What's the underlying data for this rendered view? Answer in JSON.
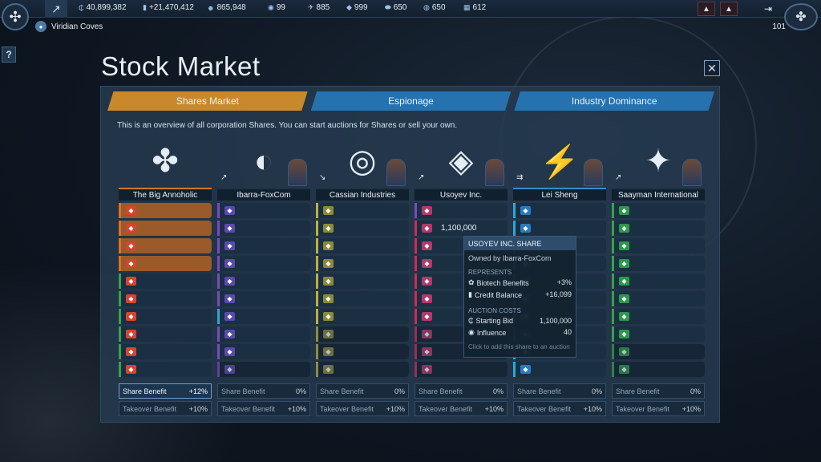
{
  "topbar": {
    "stats": [
      {
        "icon": "credits-icon",
        "glyph": "₵",
        "value": "40,899,382"
      },
      {
        "icon": "income-icon",
        "glyph": "▮",
        "value": "+21,470,412"
      },
      {
        "icon": "population-icon",
        "glyph": "☻",
        "value": "865,948"
      },
      {
        "icon": "influence-icon",
        "glyph": "◉",
        "value": "99"
      },
      {
        "icon": "ships-icon",
        "glyph": "✈",
        "value": "885"
      },
      {
        "icon": "resource-a-icon",
        "glyph": "◆",
        "value": "999"
      },
      {
        "icon": "resource-b-icon",
        "glyph": "⬬",
        "value": "650"
      },
      {
        "icon": "resource-c-icon",
        "glyph": "◍",
        "value": "650"
      },
      {
        "icon": "resource-d-icon",
        "glyph": "▦",
        "value": "612"
      }
    ],
    "location": "Viridian Coves",
    "level": "101"
  },
  "page": {
    "title": "Stock Market",
    "intro": "This is an overview of all corporation Shares. You can start auctions for Shares or sell your own."
  },
  "tabs": [
    {
      "label": "Shares Market",
      "active": true
    },
    {
      "label": "Espionage",
      "active": false
    },
    {
      "label": "Industry Dominance",
      "active": false
    }
  ],
  "corporations": [
    {
      "name": "The Big Annoholic",
      "logo": "✤",
      "icon_color": "#d7442e",
      "bar_colors": [
        "#e0701e",
        "#e0701e",
        "#e0701e",
        "#e0701e",
        "#3aa04a",
        "#3aa04a",
        "#3aa04a",
        "#3aa04a",
        "#3aa04a",
        "#3aa04a"
      ],
      "orange_rows": 4,
      "dim_from": 10,
      "share_benefit_label": "Share Benefit",
      "share_benefit_value": "+12%",
      "takeover_label": "Takeover Benefit",
      "takeover_value": "+10%",
      "highlight": true,
      "trend": "",
      "ceo": false
    },
    {
      "name": "Ibarra-FoxCom",
      "logo": "◐",
      "icon_color": "#5a4ab0",
      "bar_colors": [
        "#7a4ac0",
        "#7a4ac0",
        "#7a4ac0",
        "#7a4ac0",
        "#7a4ac0",
        "#7a4ac0",
        "#2aa8d8",
        "#7a4ac0",
        "#7a4ac0",
        "#7a4ac0"
      ],
      "orange_rows": 0,
      "dim_from": 9,
      "share_benefit_label": "Share Benefit",
      "share_benefit_value": "0%",
      "takeover_label": "Takeover Benefit",
      "takeover_value": "+10%",
      "highlight": false,
      "trend": "↗",
      "ceo": true
    },
    {
      "name": "Cassian Industries",
      "logo": "◎",
      "icon_color": "#8a8a3a",
      "bar_colors": [
        "#c0b040",
        "#c0b040",
        "#c0b040",
        "#c0b040",
        "#c0b040",
        "#c0b040",
        "#c0b040",
        "#c0b040",
        "#c0b040",
        "#c0b040"
      ],
      "orange_rows": 0,
      "dim_from": 7,
      "share_benefit_label": "Share Benefit",
      "share_benefit_value": "0%",
      "takeover_label": "Takeover Benefit",
      "takeover_value": "+10%",
      "highlight": false,
      "trend": "↘",
      "ceo": true
    },
    {
      "name": "Usoyev Inc.",
      "logo": "◈",
      "icon_color": "#b03a6a",
      "bar_colors": [
        "#7a4ac0",
        "#d02a5a",
        "#d02a5a",
        "#d02a5a",
        "#d02a5a",
        "#d02a5a",
        "#d02a5a",
        "#d02a5a",
        "#d02a5a",
        "#d02a5a"
      ],
      "orange_rows": 0,
      "dim_from": 7,
      "share_benefit_label": "Share Benefit",
      "share_benefit_value": "0%",
      "takeover_label": "Takeover Benefit",
      "takeover_value": "+10%",
      "highlight": false,
      "trend": "↗",
      "ceo": true,
      "share_price": "1,100,000"
    },
    {
      "name": "Lei Sheng",
      "logo": "⚡",
      "icon_color": "#2a7ac0",
      "bar_colors": [
        "#2aa8d8",
        "#2aa8d8",
        "#2aa8d8",
        "#2aa8d8",
        "#2aa8d8",
        "#2aa8d8",
        "#2aa8d8",
        "#2aa8d8",
        "#2aa8d8",
        "#2aa8d8"
      ],
      "orange_rows": 0,
      "dim_from": 10,
      "share_benefit_label": "Share Benefit",
      "share_benefit_value": "0%",
      "takeover_label": "Takeover Benefit",
      "takeover_value": "+10%",
      "highlight": false,
      "trend": "⇉",
      "ceo": true
    },
    {
      "name": "Saayman International",
      "logo": "✦",
      "icon_color": "#2a9a4a",
      "bar_colors": [
        "#3aa04a",
        "#3aa04a",
        "#3aa04a",
        "#3aa04a",
        "#3aa04a",
        "#3aa04a",
        "#3aa04a",
        "#3aa04a",
        "#3aa04a",
        "#3aa04a"
      ],
      "orange_rows": 0,
      "dim_from": 8,
      "share_benefit_label": "Share Benefit",
      "share_benefit_value": "0%",
      "takeover_label": "Takeover Benefit",
      "takeover_value": "+10%",
      "highlight": false,
      "trend": "↗",
      "ceo": true
    }
  ],
  "tooltip": {
    "title": "USOYEV INC. SHARE",
    "owner": "Owned by Ibarra-FoxCom",
    "represents_label": "REPRESENTS",
    "represents": [
      {
        "label": "Biotech Benefits",
        "value": "+3%",
        "glyph": "✿"
      },
      {
        "label": "Credit Balance",
        "value": "+16,099",
        "glyph": "▮"
      }
    ],
    "auction_label": "AUCTION COSTS",
    "auction": [
      {
        "label": "Starting Bid",
        "value": "1,100,000",
        "glyph": "₵"
      },
      {
        "label": "Influence",
        "value": "40",
        "glyph": "◉"
      }
    ],
    "hint": "Click to add this share to an auction"
  }
}
